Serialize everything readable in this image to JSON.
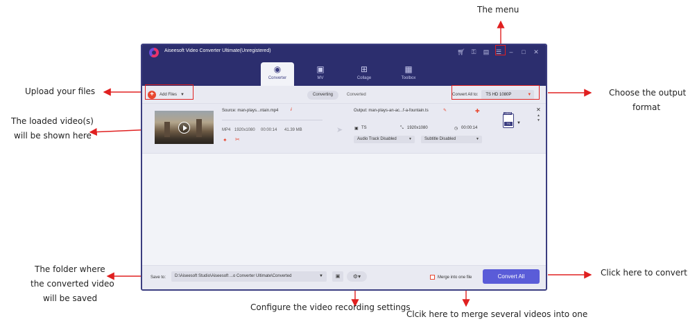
{
  "annotations": {
    "menu": "The menu",
    "upload": "Upload your files",
    "loaded_line1": "The loaded video(s)",
    "loaded_line2": "will be shown here",
    "output_line1": "Choose the output",
    "output_line2": "format",
    "folder_line1": "The folder where",
    "folder_line2": "the converted video",
    "folder_line3": "will be saved",
    "convert": "Click here to convert",
    "recording": "Configure the video recording settings",
    "merge": "Clcik here to merge several videos into one"
  },
  "app": {
    "title": "Aiseesoft Video Converter Ultimate(Unregistered)",
    "titlebar_icons": [
      "cart-icon",
      "key-icon",
      "chat-icon",
      "menu-icon",
      "minimize-icon",
      "maximize-icon",
      "close-icon"
    ],
    "tabs": [
      {
        "label": "Converter",
        "icon": "converter-icon"
      },
      {
        "label": "MV",
        "icon": "mv-icon"
      },
      {
        "label": "Collage",
        "icon": "collage-icon"
      },
      {
        "label": "Toolbox",
        "icon": "toolbox-icon"
      }
    ],
    "active_tab": "Converter"
  },
  "toolbar": {
    "add_files": "Add Files",
    "segments": [
      "Converting",
      "Converted"
    ],
    "active_segment": "Converting",
    "convert_all_label": "Convert All to:",
    "convert_all_value": "TS HD 1080P"
  },
  "item": {
    "source": "Source: man-plays...ntain.mp4",
    "meta_format": "MP4",
    "meta_resolution": "1920x1080",
    "meta_duration": "00:00:14",
    "meta_size": "41.39 MB",
    "output": "Output: man-plays-an-ac...f-a-fountain.ts",
    "out_format": "TS",
    "out_resolution": "1920x1080",
    "out_duration": "00:00:14",
    "audio_track": "Audio Track Disabled",
    "subtitle": "Subtitle Disabled",
    "badge_top": "1080P",
    "badge_bottom": "TS"
  },
  "footer": {
    "save_to_label": "Save to:",
    "save_path": "D:\\Aiseesoft Studio\\Aiseesoft ...o Converter Ultimate\\Converted",
    "merge_label": "Merge into one file",
    "convert_all_button": "Convert All"
  },
  "colors": {
    "titlebar": "#2c2e6e",
    "accent": "#5a5cd8",
    "orange": "#e8472f",
    "annotation_red": "#e02020"
  }
}
